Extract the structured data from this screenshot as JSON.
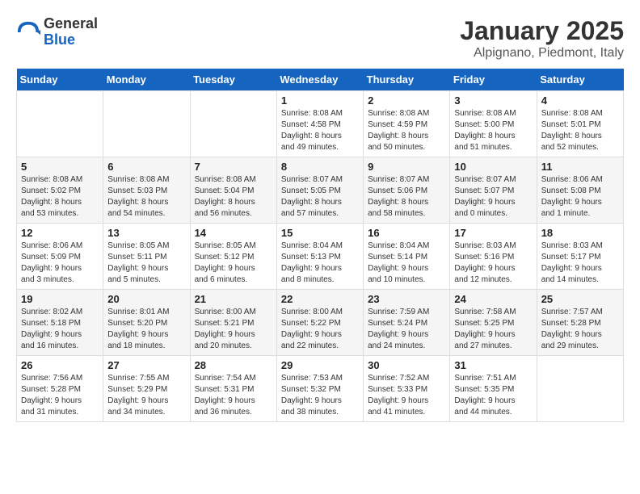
{
  "header": {
    "logo": {
      "line1": "General",
      "line2": "Blue"
    },
    "title": "January 2025",
    "subtitle": "Alpignano, Piedmont, Italy"
  },
  "days_of_week": [
    "Sunday",
    "Monday",
    "Tuesday",
    "Wednesday",
    "Thursday",
    "Friday",
    "Saturday"
  ],
  "weeks": [
    [
      {
        "day": "",
        "info": ""
      },
      {
        "day": "",
        "info": ""
      },
      {
        "day": "",
        "info": ""
      },
      {
        "day": "1",
        "info": "Sunrise: 8:08 AM\nSunset: 4:58 PM\nDaylight: 8 hours\nand 49 minutes."
      },
      {
        "day": "2",
        "info": "Sunrise: 8:08 AM\nSunset: 4:59 PM\nDaylight: 8 hours\nand 50 minutes."
      },
      {
        "day": "3",
        "info": "Sunrise: 8:08 AM\nSunset: 5:00 PM\nDaylight: 8 hours\nand 51 minutes."
      },
      {
        "day": "4",
        "info": "Sunrise: 8:08 AM\nSunset: 5:01 PM\nDaylight: 8 hours\nand 52 minutes."
      }
    ],
    [
      {
        "day": "5",
        "info": "Sunrise: 8:08 AM\nSunset: 5:02 PM\nDaylight: 8 hours\nand 53 minutes."
      },
      {
        "day": "6",
        "info": "Sunrise: 8:08 AM\nSunset: 5:03 PM\nDaylight: 8 hours\nand 54 minutes."
      },
      {
        "day": "7",
        "info": "Sunrise: 8:08 AM\nSunset: 5:04 PM\nDaylight: 8 hours\nand 56 minutes."
      },
      {
        "day": "8",
        "info": "Sunrise: 8:07 AM\nSunset: 5:05 PM\nDaylight: 8 hours\nand 57 minutes."
      },
      {
        "day": "9",
        "info": "Sunrise: 8:07 AM\nSunset: 5:06 PM\nDaylight: 8 hours\nand 58 minutes."
      },
      {
        "day": "10",
        "info": "Sunrise: 8:07 AM\nSunset: 5:07 PM\nDaylight: 9 hours\nand 0 minutes."
      },
      {
        "day": "11",
        "info": "Sunrise: 8:06 AM\nSunset: 5:08 PM\nDaylight: 9 hours\nand 1 minute."
      }
    ],
    [
      {
        "day": "12",
        "info": "Sunrise: 8:06 AM\nSunset: 5:09 PM\nDaylight: 9 hours\nand 3 minutes."
      },
      {
        "day": "13",
        "info": "Sunrise: 8:05 AM\nSunset: 5:11 PM\nDaylight: 9 hours\nand 5 minutes."
      },
      {
        "day": "14",
        "info": "Sunrise: 8:05 AM\nSunset: 5:12 PM\nDaylight: 9 hours\nand 6 minutes."
      },
      {
        "day": "15",
        "info": "Sunrise: 8:04 AM\nSunset: 5:13 PM\nDaylight: 9 hours\nand 8 minutes."
      },
      {
        "day": "16",
        "info": "Sunrise: 8:04 AM\nSunset: 5:14 PM\nDaylight: 9 hours\nand 10 minutes."
      },
      {
        "day": "17",
        "info": "Sunrise: 8:03 AM\nSunset: 5:16 PM\nDaylight: 9 hours\nand 12 minutes."
      },
      {
        "day": "18",
        "info": "Sunrise: 8:03 AM\nSunset: 5:17 PM\nDaylight: 9 hours\nand 14 minutes."
      }
    ],
    [
      {
        "day": "19",
        "info": "Sunrise: 8:02 AM\nSunset: 5:18 PM\nDaylight: 9 hours\nand 16 minutes."
      },
      {
        "day": "20",
        "info": "Sunrise: 8:01 AM\nSunset: 5:20 PM\nDaylight: 9 hours\nand 18 minutes."
      },
      {
        "day": "21",
        "info": "Sunrise: 8:00 AM\nSunset: 5:21 PM\nDaylight: 9 hours\nand 20 minutes."
      },
      {
        "day": "22",
        "info": "Sunrise: 8:00 AM\nSunset: 5:22 PM\nDaylight: 9 hours\nand 22 minutes."
      },
      {
        "day": "23",
        "info": "Sunrise: 7:59 AM\nSunset: 5:24 PM\nDaylight: 9 hours\nand 24 minutes."
      },
      {
        "day": "24",
        "info": "Sunrise: 7:58 AM\nSunset: 5:25 PM\nDaylight: 9 hours\nand 27 minutes."
      },
      {
        "day": "25",
        "info": "Sunrise: 7:57 AM\nSunset: 5:28 PM\nDaylight: 9 hours\nand 29 minutes."
      }
    ],
    [
      {
        "day": "26",
        "info": "Sunrise: 7:56 AM\nSunset: 5:28 PM\nDaylight: 9 hours\nand 31 minutes."
      },
      {
        "day": "27",
        "info": "Sunrise: 7:55 AM\nSunset: 5:29 PM\nDaylight: 9 hours\nand 34 minutes."
      },
      {
        "day": "28",
        "info": "Sunrise: 7:54 AM\nSunset: 5:31 PM\nDaylight: 9 hours\nand 36 minutes."
      },
      {
        "day": "29",
        "info": "Sunrise: 7:53 AM\nSunset: 5:32 PM\nDaylight: 9 hours\nand 38 minutes."
      },
      {
        "day": "30",
        "info": "Sunrise: 7:52 AM\nSunset: 5:33 PM\nDaylight: 9 hours\nand 41 minutes."
      },
      {
        "day": "31",
        "info": "Sunrise: 7:51 AM\nSunset: 5:35 PM\nDaylight: 9 hours\nand 44 minutes."
      },
      {
        "day": "",
        "info": ""
      }
    ]
  ]
}
